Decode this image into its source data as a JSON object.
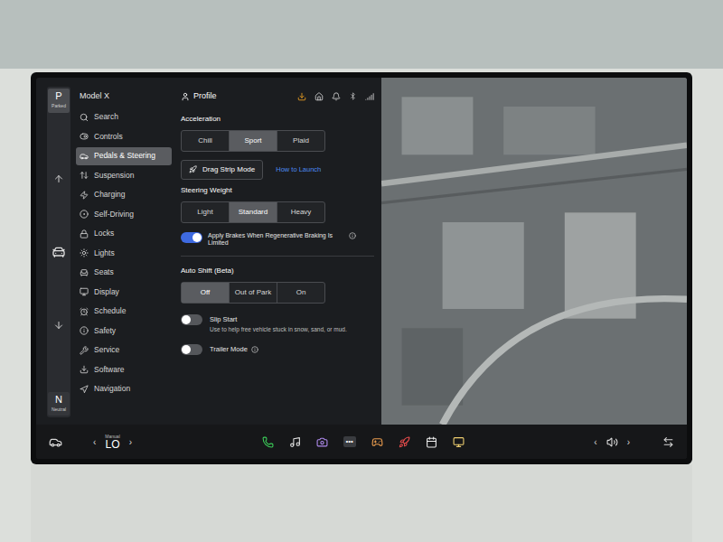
{
  "gear": {
    "items": [
      {
        "label": "P",
        "sub": "Parked",
        "selected": true
      },
      {
        "label": "N",
        "sub": "Neutral",
        "selected": false
      }
    ]
  },
  "sidebar": {
    "title": "Model X",
    "items": [
      {
        "label": "Search",
        "selected": false
      },
      {
        "label": "Controls",
        "selected": false
      },
      {
        "label": "Pedals & Steering",
        "selected": true
      },
      {
        "label": "Suspension",
        "selected": false
      },
      {
        "label": "Charging",
        "selected": false
      },
      {
        "label": "Self-Driving",
        "selected": false
      },
      {
        "label": "Locks",
        "selected": false
      },
      {
        "label": "Lights",
        "selected": false
      },
      {
        "label": "Seats",
        "selected": false
      },
      {
        "label": "Display",
        "selected": false
      },
      {
        "label": "Schedule",
        "selected": false
      },
      {
        "label": "Safety",
        "selected": false
      },
      {
        "label": "Service",
        "selected": false
      },
      {
        "label": "Software",
        "selected": false
      },
      {
        "label": "Navigation",
        "selected": false
      }
    ]
  },
  "header": {
    "title": "Profile"
  },
  "acceleration": {
    "title": "Acceleration",
    "options": [
      {
        "label": "Chill",
        "selected": false
      },
      {
        "label": "Sport",
        "selected": true
      },
      {
        "label": "Plaid",
        "selected": false
      }
    ]
  },
  "drag_strip": {
    "label": "Drag Strip Mode",
    "link": "How to Launch"
  },
  "steering_weight": {
    "title": "Steering Weight",
    "options": [
      {
        "label": "Light",
        "selected": false
      },
      {
        "label": "Standard",
        "selected": true
      },
      {
        "label": "Heavy",
        "selected": false
      }
    ]
  },
  "regen": {
    "label": "Apply Brakes When Regenerative Braking Is Limited",
    "on": true
  },
  "auto_shift": {
    "title": "Auto Shift (Beta)",
    "options": [
      {
        "label": "Off",
        "selected": true
      },
      {
        "label": "Out of Park",
        "selected": false
      },
      {
        "label": "On",
        "selected": false
      }
    ]
  },
  "toggles": [
    {
      "label": "Slip Start",
      "description": "Use to help free vehicle stuck in snow, sand, or mud.",
      "on": false,
      "info": false
    },
    {
      "label": "Trailer Mode",
      "description": "",
      "on": false,
      "info": true
    }
  ],
  "bottom_bar": {
    "climate": {
      "mode": "Manual",
      "temp": "LO",
      "prev": "‹",
      "next": "›"
    },
    "dots": "•••",
    "volume": {
      "prev": "‹",
      "next": "›"
    }
  }
}
